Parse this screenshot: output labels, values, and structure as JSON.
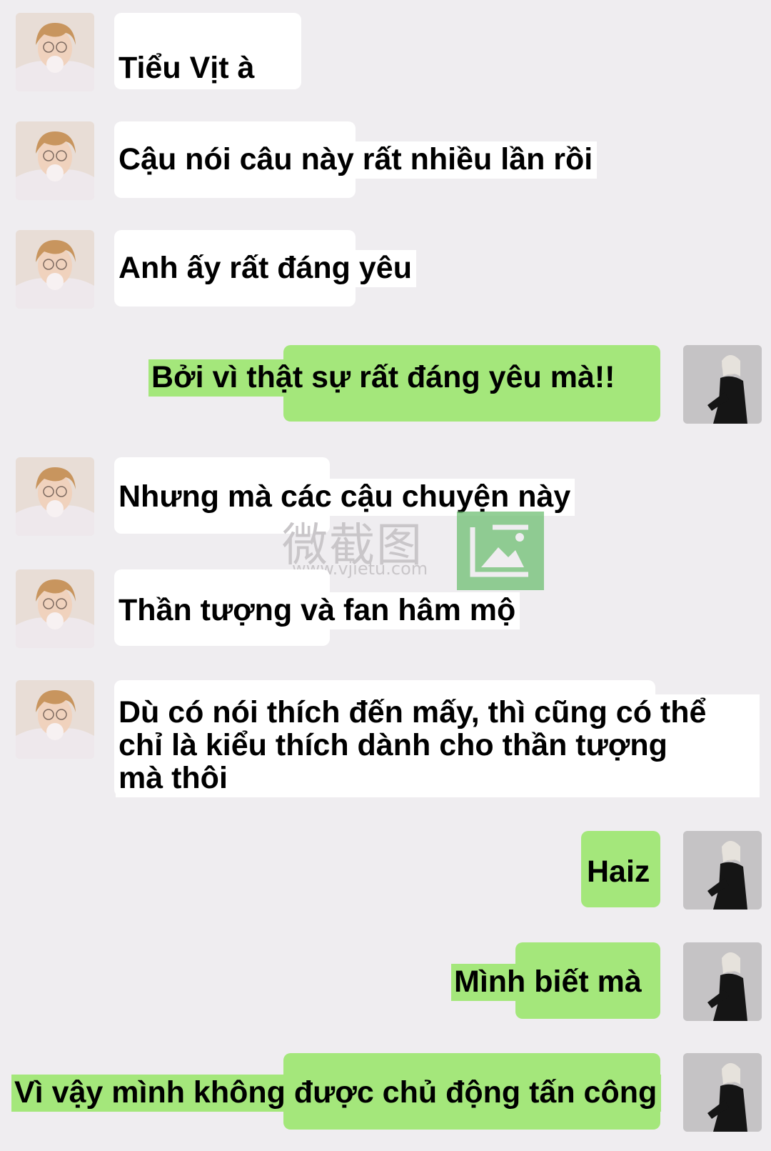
{
  "colors": {
    "background": "#efedf0",
    "incoming_bubble": "#ffffff",
    "outgoing_bubble": "#a4e77b"
  },
  "messages": [
    {
      "side": "incoming",
      "text": "Tiểu Vịt à"
    },
    {
      "side": "incoming",
      "text": "Cậu nói câu này rất nhiều lần rồi"
    },
    {
      "side": "incoming",
      "text": "Anh ấy rất đáng yêu"
    },
    {
      "side": "outgoing",
      "text": "Bởi vì thật sự rất đáng yêu mà!!"
    },
    {
      "side": "incoming",
      "text": "Nhưng mà các cậu chuyện này"
    },
    {
      "side": "incoming",
      "text": "Thần tượng và fan hâm mộ"
    },
    {
      "side": "incoming",
      "text": "Dù có nói thích đến mấy, thì cũng có thể\nchỉ là kiểu thích dành cho thần tượng\nmà thôi"
    },
    {
      "side": "outgoing",
      "text": "Haiz"
    },
    {
      "side": "outgoing",
      "text": "Mình biết mà"
    },
    {
      "side": "outgoing",
      "text": "Vì vậy mình không được chủ động tấn công"
    }
  ],
  "watermark": {
    "chars": "微截图",
    "url": "www.vjietu.com"
  },
  "icons": {
    "incoming_avatar": "avatar-boy-bubblegum",
    "outgoing_avatar": "avatar-girl-black-outfit",
    "watermark_logo": "image-frame-icon"
  }
}
